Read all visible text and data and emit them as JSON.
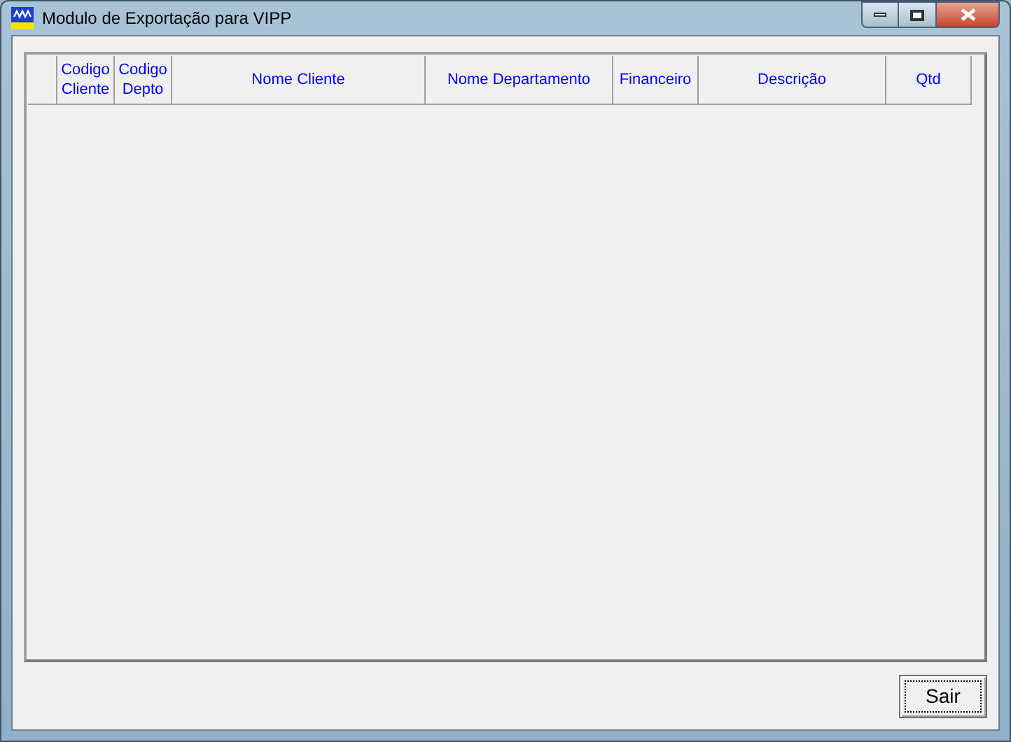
{
  "window": {
    "title": "Modulo de Exportação para VIPP"
  },
  "table": {
    "columns": [
      "Codigo Cliente",
      "Codigo Depto",
      "Nome Cliente",
      "Nome Departamento",
      "Financeiro",
      "Descrição",
      "Qtd"
    ]
  },
  "buttons": [
    {
      "label": "Sair"
    }
  ]
}
